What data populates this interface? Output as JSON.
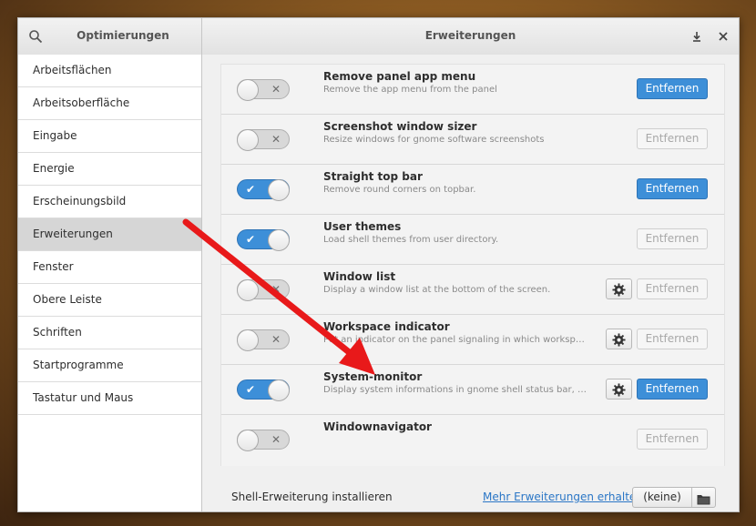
{
  "window": {
    "left_title": "Optimierungen",
    "center_title": "Erweiterungen"
  },
  "sidebar": {
    "items": [
      {
        "label": "Arbeitsflächen"
      },
      {
        "label": "Arbeitsoberfläche"
      },
      {
        "label": "Eingabe"
      },
      {
        "label": "Energie"
      },
      {
        "label": "Erscheinungsbild"
      },
      {
        "label": "Erweiterungen",
        "selected": true
      },
      {
        "label": "Fenster"
      },
      {
        "label": "Obere Leiste"
      },
      {
        "label": "Schriften"
      },
      {
        "label": "Startprogramme"
      },
      {
        "label": "Tastatur und Maus"
      }
    ]
  },
  "extensions": [
    {
      "name": "Remove panel app menu",
      "description": "Remove the app menu from the panel",
      "enabled": false,
      "has_settings": false,
      "remove_label": "Entfernen",
      "remove_active": true
    },
    {
      "name": "Screenshot window sizer",
      "description": "Resize windows for gnome software screenshots",
      "enabled": false,
      "has_settings": false,
      "remove_label": "Entfernen",
      "remove_active": false
    },
    {
      "name": "Straight top bar",
      "description": "Remove round corners on topbar.",
      "enabled": true,
      "has_settings": false,
      "remove_label": "Entfernen",
      "remove_active": true
    },
    {
      "name": "User themes",
      "description": "Load shell themes from user directory.",
      "enabled": true,
      "has_settings": false,
      "remove_label": "Entfernen",
      "remove_active": false
    },
    {
      "name": "Window list",
      "description": "Display a window list at the bottom of the screen.",
      "enabled": false,
      "has_settings": true,
      "remove_label": "Entfernen",
      "remove_active": false
    },
    {
      "name": "Workspace indicator",
      "description": "Put an indicator on the panel signaling in which workspace you are",
      "enabled": false,
      "has_settings": true,
      "remove_label": "Entfernen",
      "remove_active": false
    },
    {
      "name": "System-monitor",
      "description": "Display system informations in gnome shell status bar, such as memory usage",
      "enabled": true,
      "has_settings": true,
      "remove_label": "Entfernen",
      "remove_active": true
    },
    {
      "name": "Windownavigator",
      "description": "",
      "enabled": false,
      "has_settings": false,
      "remove_label": "Entfernen",
      "remove_active": false
    }
  ],
  "footer": {
    "install_label": "Shell-Erweiterung installieren",
    "more_link": "Mehr Erweiterungen erhalten",
    "file_value": "(keine)"
  },
  "icons": {
    "search": "search-icon",
    "download": "download-icon",
    "close": "close-icon",
    "gear": "gear-icon",
    "folder": "folder-icon",
    "check": "✔",
    "cross": "✕"
  },
  "colors": {
    "accent": "#3d8fd8",
    "annotation_arrow": "#e8191a"
  }
}
